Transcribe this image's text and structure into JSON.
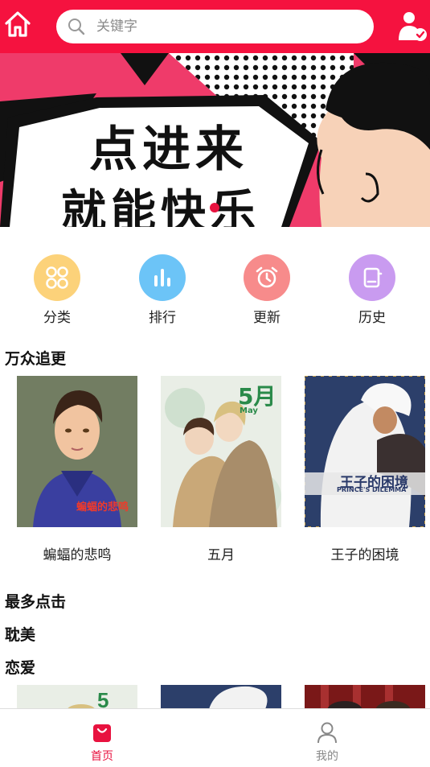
{
  "header": {
    "search_placeholder": "关键字",
    "home_icon": "home-icon",
    "user_icon": "user-check-icon"
  },
  "banner": {
    "line1": "点进来",
    "line2": "就能快乐"
  },
  "categories": [
    {
      "label": "分类",
      "icon": "grid-icon",
      "color": "#fcd27a"
    },
    {
      "label": "排行",
      "icon": "bar-chart-icon",
      "color": "#6cc4f7"
    },
    {
      "label": "更新",
      "icon": "alarm-clock-icon",
      "color": "#f78b8b"
    },
    {
      "label": "历史",
      "icon": "book-icon",
      "color": "#c99bf0"
    }
  ],
  "sections": {
    "popular": "万众追更",
    "most_clicked": "最多点击",
    "bl": "耽美",
    "romance": "恋爱"
  },
  "comics": [
    {
      "title": "蝙蝠的悲鸣",
      "cover_text": "蝙蝠的悲鸣"
    },
    {
      "title": "五月",
      "cover_text": "5月",
      "cover_sub": "May"
    },
    {
      "title": "王子的困境",
      "cover_text": "王子的困境",
      "cover_sub": "PRINCE'S DILEMMA"
    }
  ],
  "bottom_nav": {
    "home": "首页",
    "mine": "我的"
  },
  "colors": {
    "brand": "#f5123f",
    "tab_active": "#e8123f",
    "tab_inactive": "#888888"
  }
}
